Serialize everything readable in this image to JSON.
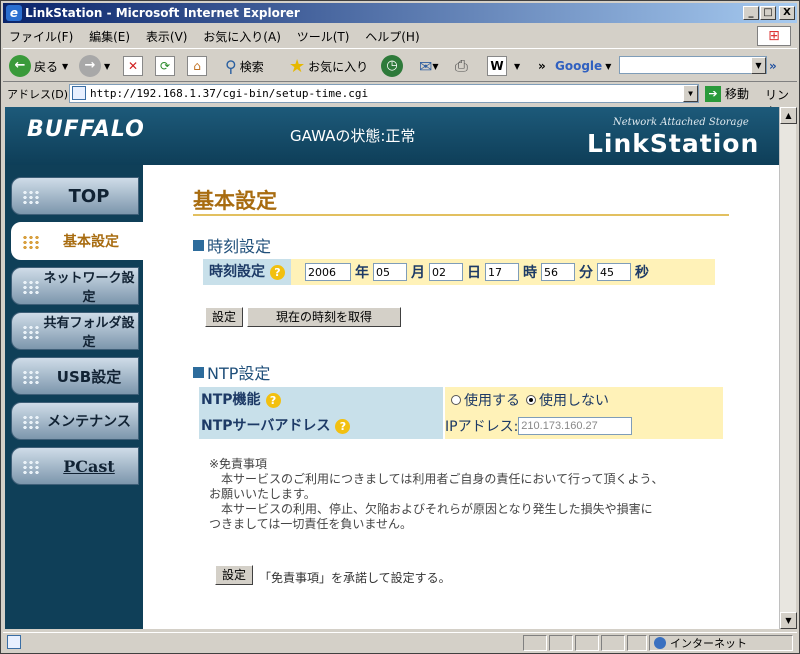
{
  "window": {
    "title": "LinkStation - Microsoft Internet Explorer",
    "min": "_",
    "max": "□",
    "close": "X"
  },
  "menu": [
    "ファイル(F)",
    "編集(E)",
    "表示(V)",
    "お気に入り(A)",
    "ツール(T)",
    "ヘルプ(H)"
  ],
  "toolbar": {
    "back": "戻る",
    "search": "検索",
    "favorites": "お気に入り",
    "google": "Google",
    "more": "»"
  },
  "address": {
    "label": "アドレス(D)",
    "url": "http://192.168.1.37/cgi-bin/setup-time.cgi",
    "go": "移動",
    "links": "リンク"
  },
  "header": {
    "logo": "BUFFALO",
    "status": "GAWAの状態:正常",
    "product_sub": "Network Attached Storage",
    "product": "LinkStation"
  },
  "nav": [
    {
      "label": "TOP",
      "active": false
    },
    {
      "label": "基本設定",
      "active": true
    },
    {
      "label": "ネットワーク設定",
      "active": false
    },
    {
      "label": "共有フォルダ設定",
      "active": false
    },
    {
      "label": "USB設定",
      "active": false
    },
    {
      "label": "メンテナンス",
      "active": false
    },
    {
      "label": "PCast",
      "active": false
    }
  ],
  "content": {
    "title": "基本設定",
    "time_section": "時刻設定",
    "time_label": "時刻設定",
    "help": "?",
    "year": "2006",
    "year_unit": "年",
    "month": "05",
    "month_unit": "月",
    "day": "02",
    "day_unit": "日",
    "hour": "17",
    "hour_unit": "時",
    "minute": "56",
    "minute_unit": "分",
    "second": "45",
    "second_unit": "秒",
    "set_button": "設定",
    "get_time_button": "現在の時刻を取得",
    "ntp_section": "NTP設定",
    "ntp_function_label": "NTP機能",
    "ntp_use": "使用する",
    "ntp_not_use": "使用しない",
    "ntp_server_label": "NTPサーバアドレス",
    "ip_label": "IPアドレス:",
    "ip_value": "210.173.160.27",
    "notice_lines": [
      "※免責事項",
      "　本サービスのご利用につきましては利用者ご自身の責任において行って頂くよう、",
      "お願いいたします。",
      "　本サービスの利用、停止、欠陥およびそれらが原因となり発生した損失や損害に",
      "つきましては一切責任を負いません。"
    ],
    "submit_button": "設定",
    "submit_note": "「免責事項」を承諾して設定する。"
  },
  "statusbar": {
    "zone": "インターネット"
  }
}
